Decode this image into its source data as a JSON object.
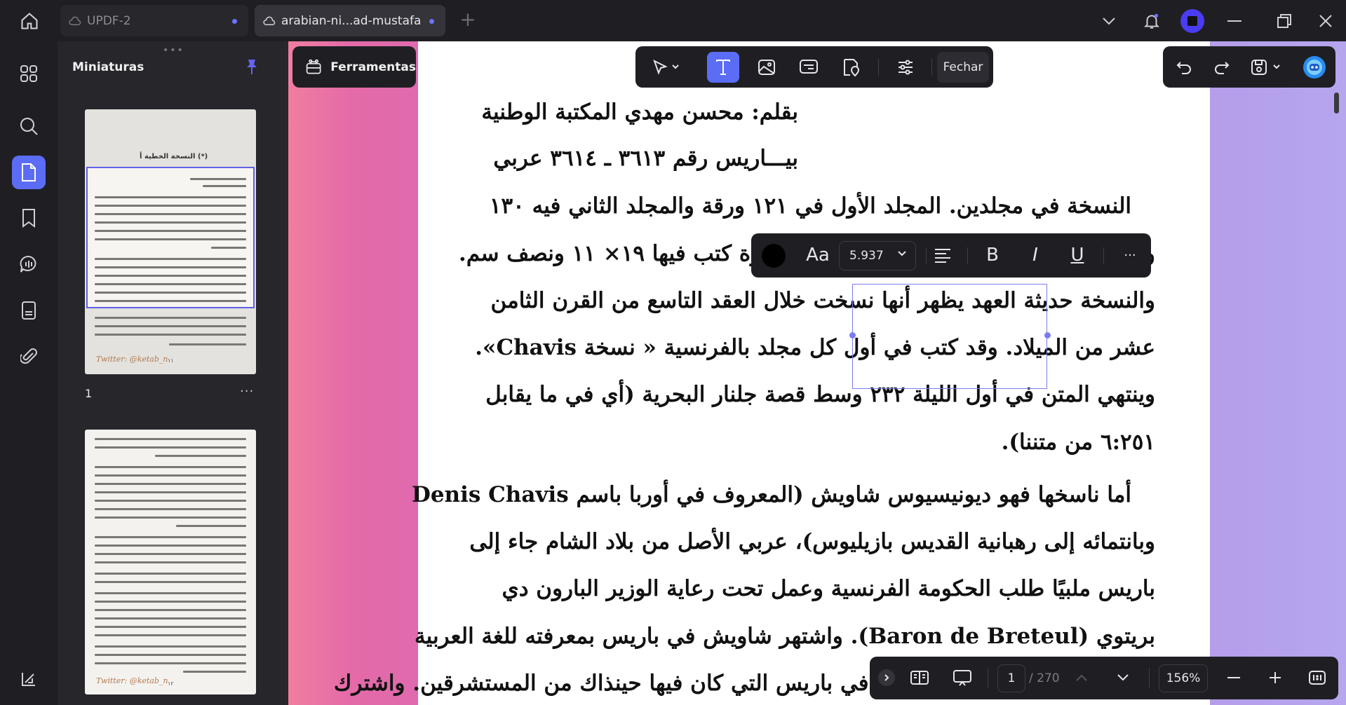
{
  "tabs": [
    {
      "label": "UPDF-2"
    },
    {
      "label": "arabian-ni...ad-mustafa"
    }
  ],
  "thumbnails": {
    "title": "Miniaturas",
    "page1_label": "1",
    "thumb1_title": "النسخة الخطية أ (*)",
    "twitter_handle": "Twitter: @ketab_n",
    "thumb1_num": "١١",
    "thumb2_num": "١٢"
  },
  "toolbar": {
    "tools_label": "Ferramentas",
    "close_label": "Fechar"
  },
  "format_bar": {
    "font_size": "5.937",
    "font_label": "Aa",
    "bold": "B",
    "italic": "I",
    "underline": "U",
    "more": "···"
  },
  "document": {
    "lines": [
      "بقلم: محسن مهدي المكتبة الوطنية",
      "بيـــاريس رقم ٣٦١٣ ـ ٣٦١٤ عربي",
      "النسخة في مجلدين. المجلد الأول في ١٢١ ورقة والمجلد الثاني فيه ١٣٠",
      "ورقة، ومقاسها ٣٣ × ١٧ ونصف سم ومسطرة كتب فيها ١٩× ١١ ونصف سم.",
      "والنسخة حديثة العهد يظهر أنها نسخت خلال العقد التاسع من القرن الثامن",
      "عشر من الميلاد. وقد كتب في أول كل مجلد بالفرنسية « نسخة Chavis».",
      "وينتهي المتن في أول الليلة ٢٣٢ وسط قصة جلنار البحرية (أي في ما يقابل",
      "٦:٢٥١ من متننا).",
      "أما ناسخها فهو ديونيسيوس شاويش (المعروف في أوربا باسم Denis Chavis",
      "وبانتمائه إلى رهبانية القديس بازيليوس)، عربي الأصل من بلاد الشام جاء إلى",
      "باريس ملبيًا طلب الحكومة الفرنسية وعمل تحت رعاية الوزير البارون دي",
      "بريتوي (Baron de Breteul). واشتهر شاويش في باريس بمعرفته للغة العربية",
      "التي كان يتكلمها ويكتبها بطلاقة في باريس التي كان فيها حينذاك من المستشرقين. واشترك"
    ]
  },
  "navigation": {
    "current_page": "1",
    "total_pages": "/ 270",
    "zoom": "156%"
  },
  "colors": {
    "accent": "#5b6cf5",
    "chrome": "#1f1f23",
    "selection": "#7c7cf0"
  }
}
